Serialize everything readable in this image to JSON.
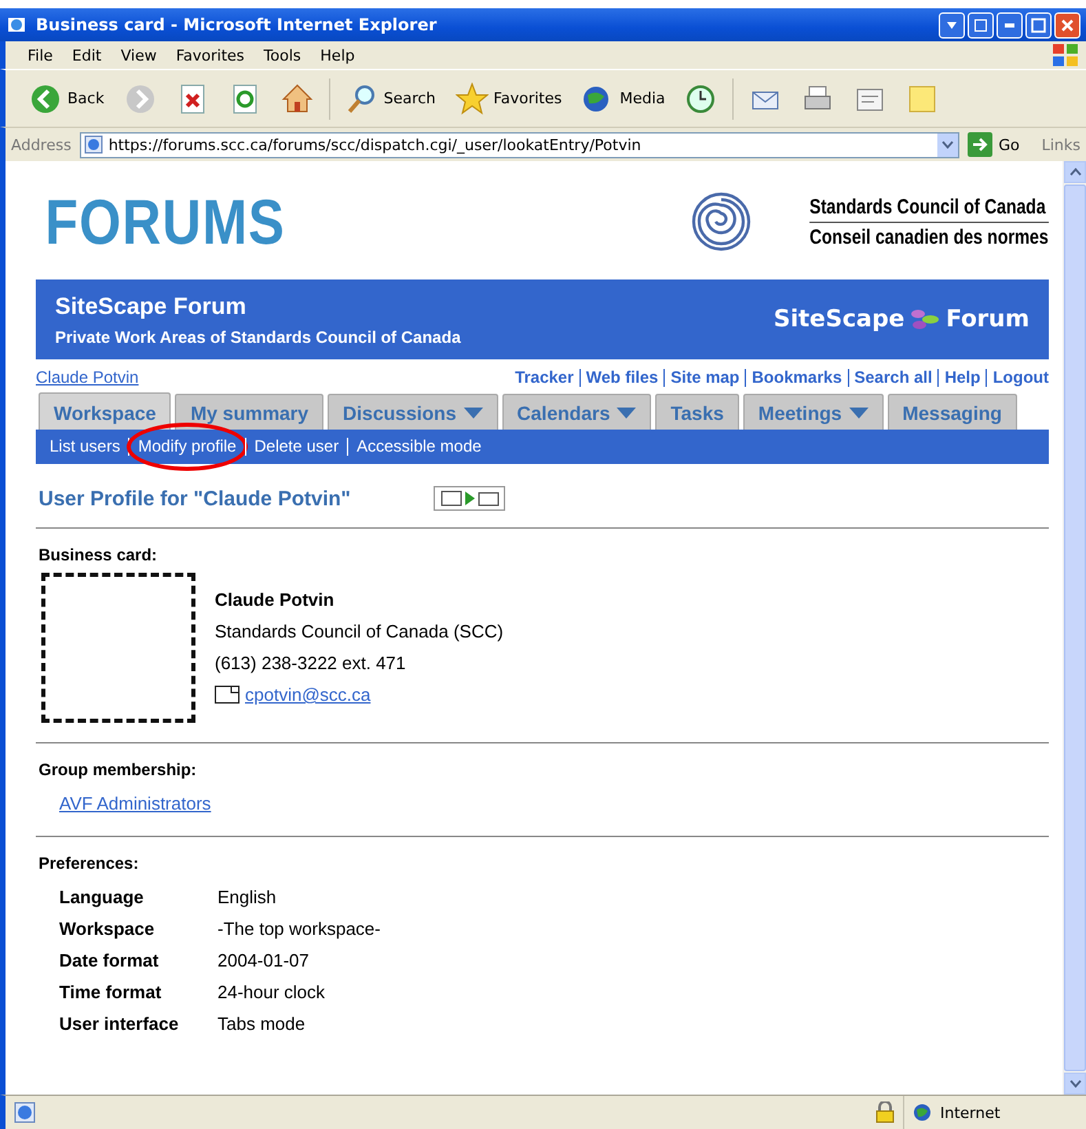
{
  "window": {
    "title": "Business card - Microsoft Internet Explorer"
  },
  "menu": [
    "File",
    "Edit",
    "View",
    "Favorites",
    "Tools",
    "Help"
  ],
  "toolbar": [
    {
      "kind": "back",
      "label": "Back"
    },
    {
      "kind": "forward"
    },
    {
      "kind": "stop"
    },
    {
      "kind": "refresh"
    },
    {
      "kind": "home"
    },
    {
      "kind": "search",
      "label": "Search"
    },
    {
      "kind": "favorites",
      "label": "Favorites"
    },
    {
      "kind": "media",
      "label": "Media"
    },
    {
      "kind": "history"
    },
    {
      "kind": "mail"
    },
    {
      "kind": "print"
    },
    {
      "kind": "edit"
    },
    {
      "kind": "note"
    }
  ],
  "address": {
    "label": "Address",
    "url": "https://forums.scc.ca/forums/scc/dispatch.cgi/_user/lookatEntry/Potvin",
    "go": "Go",
    "links": "Links"
  },
  "page": {
    "logo": "FORUMS",
    "org": [
      "Standards Council of Canada",
      "Conseil canadien des normes"
    ],
    "banner": {
      "title": "SiteScape Forum",
      "subtitle": "Private Work Areas of Standards Council of Canada",
      "brand_left": "SiteScape",
      "brand_right": "Forum"
    },
    "user": "Claude Potvin",
    "header_links": [
      "Tracker",
      "Web files",
      "Site map",
      "Bookmarks",
      "Search all",
      "Help",
      "Logout"
    ],
    "tabs": [
      {
        "label": "Workspace",
        "selected": true,
        "dropdown": false
      },
      {
        "label": "My summary",
        "selected": false,
        "dropdown": false
      },
      {
        "label": "Discussions",
        "selected": false,
        "dropdown": true
      },
      {
        "label": "Calendars",
        "selected": false,
        "dropdown": true
      },
      {
        "label": "Tasks",
        "selected": false,
        "dropdown": false
      },
      {
        "label": "Meetings",
        "selected": false,
        "dropdown": true
      },
      {
        "label": "Messaging",
        "selected": false,
        "dropdown": false
      }
    ],
    "sub_nav": [
      {
        "label": "List users",
        "circled": false
      },
      {
        "label": "Modify profile",
        "circled": true
      },
      {
        "label": "Delete user",
        "circled": false
      },
      {
        "label": "Accessible mode",
        "circled": false
      }
    ],
    "profile_title": "User Profile for \"Claude Potvin\"",
    "business_card": {
      "heading": "Business card:",
      "name": "Claude Potvin",
      "organization": "Standards Council of Canada (SCC)",
      "phone": "(613) 238-3222 ext. 471",
      "email": "cpotvin@scc.ca"
    },
    "groups": {
      "heading": "Group membership:",
      "items": [
        "AVF Administrators"
      ]
    },
    "preferences": {
      "heading": "Preferences:",
      "rows": [
        {
          "label": "Language",
          "value": "English"
        },
        {
          "label": "Workspace",
          "value": "-The top workspace-"
        },
        {
          "label": "Date format",
          "value": "2004-01-07"
        },
        {
          "label": "Time format",
          "value": "24-hour clock"
        },
        {
          "label": "User interface",
          "value": "Tabs mode"
        }
      ]
    }
  },
  "status_bar": {
    "zone": "Internet"
  }
}
